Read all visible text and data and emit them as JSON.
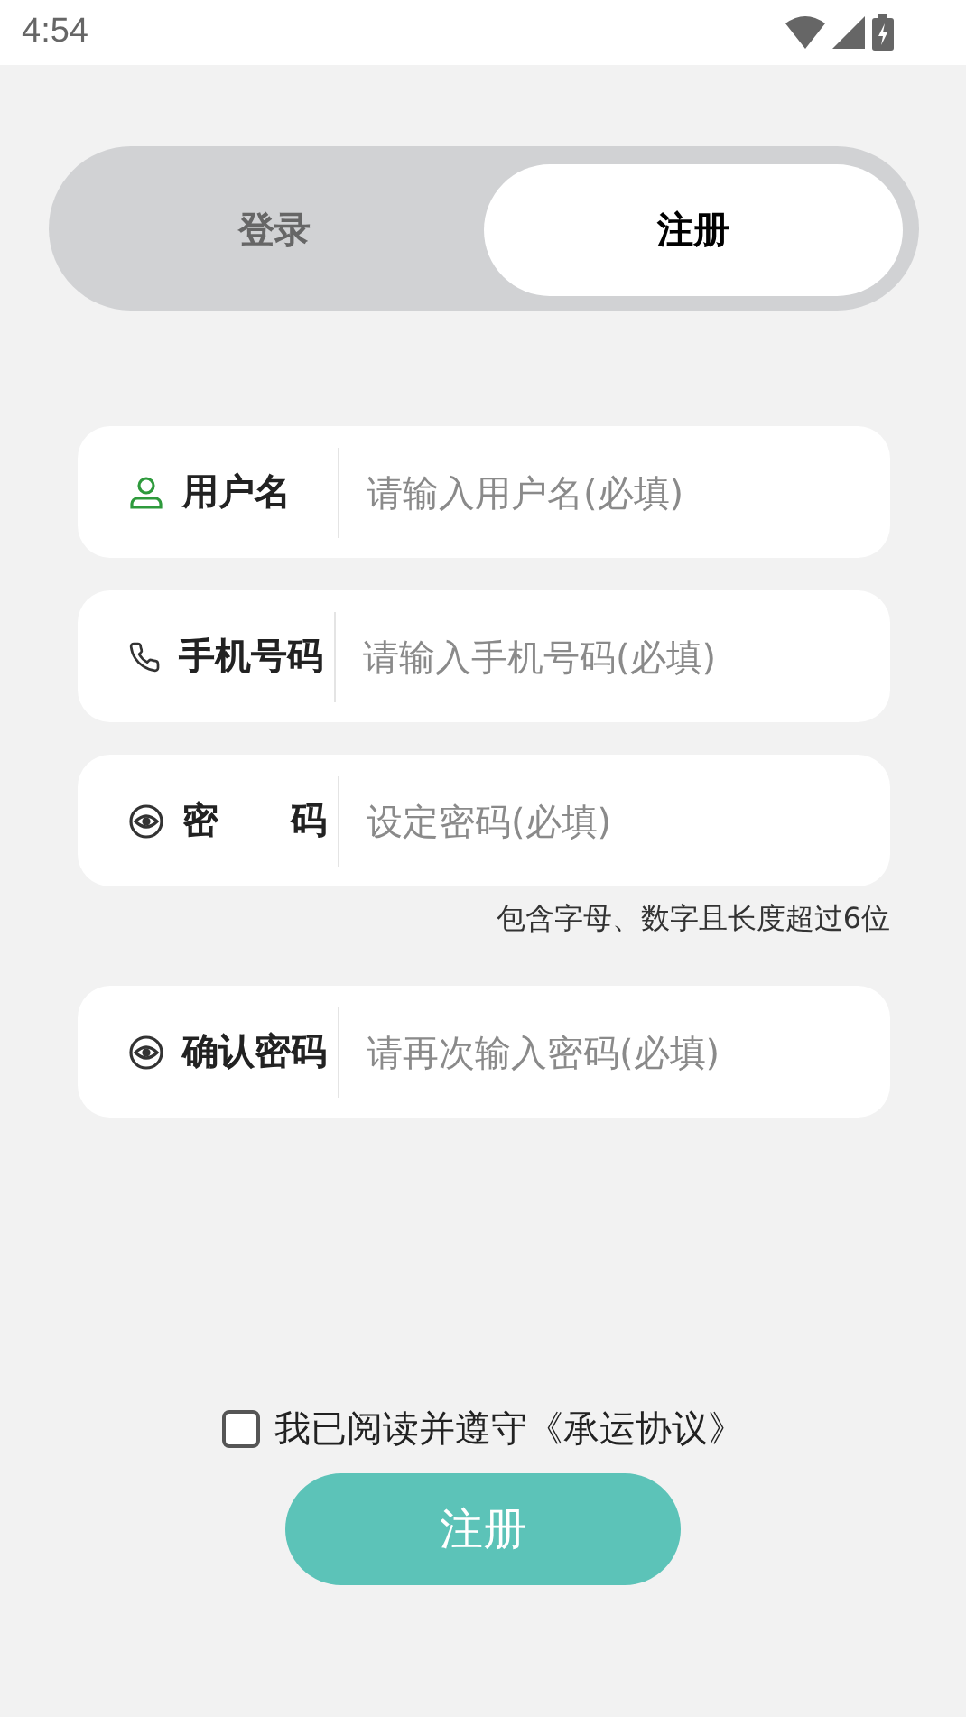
{
  "status_bar": {
    "time": "4:54"
  },
  "tabs": [
    {
      "label": "登录",
      "selected": false
    },
    {
      "label": "注册",
      "selected": true
    }
  ],
  "fields": [
    {
      "kind": "person",
      "label": "用户名",
      "placeholder": "请输入用户名(必填)"
    },
    {
      "kind": "phone",
      "label": "手机号码",
      "placeholder": "请输入手机号码(必填)"
    },
    {
      "kind": "eye",
      "label": "密　　码",
      "placeholder": "设定密码(必填)",
      "hint": "包含字母、数字且长度超过6位"
    },
    {
      "kind": "eye",
      "label": "确认密码",
      "placeholder": "请再次输入密码(必填)"
    }
  ],
  "agreement": {
    "checked": false,
    "text": "我已阅读并遵守《承运协议》"
  },
  "submit_button": "注册"
}
